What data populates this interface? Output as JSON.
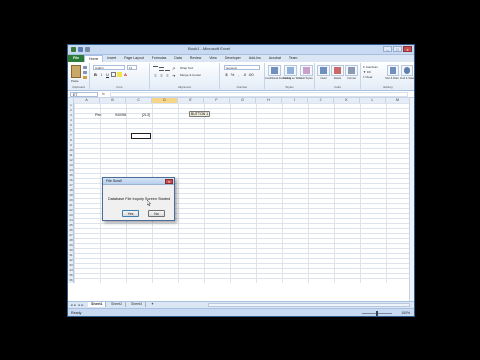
{
  "window": {
    "title": "Book1 - Microsoft Excel",
    "minimize": "–",
    "maximize": "□",
    "close": "x"
  },
  "ribbon_tabs": [
    "File",
    "Home",
    "Insert",
    "Page Layout",
    "Formulas",
    "Data",
    "Review",
    "View",
    "Developer",
    "Add-Ins",
    "Acrobat",
    "Team"
  ],
  "ribbon": {
    "paste": "Paste",
    "font_name": "Calibri",
    "font_size": "11",
    "wrap_text": "Wrap Text",
    "merge_center": "Merge & Center",
    "number_format": "General",
    "conditional_formatting": "Conditional Formatting",
    "format_as_table": "Format as Table",
    "cell_styles": "Cell Styles",
    "insert": "Insert",
    "delete": "Delete",
    "format": "Format",
    "autosum": "AutoSum",
    "fill": "Fill",
    "clear": "Clear",
    "sort_filter": "Sort & Filter",
    "find_select": "Find & Select",
    "groups": [
      "Clipboard",
      "Font",
      "Alignment",
      "Number",
      "Styles",
      "Cells",
      "Editing"
    ]
  },
  "formula_bar": {
    "name_box": "E7",
    "fx": "fx",
    "formula": ""
  },
  "columns": [
    "A",
    "B",
    "C",
    "D",
    "E",
    "F",
    "G",
    "H",
    "I",
    "J",
    "K",
    "L",
    "M"
  ],
  "selected_column": "D",
  "rows": [
    "1",
    "2",
    "3",
    "4",
    "5",
    "6",
    "7",
    "8",
    "9",
    "10",
    "11",
    "12",
    "13",
    "14",
    "15",
    "16",
    "17",
    "18",
    "19",
    "20",
    "21",
    "22",
    "23",
    "24",
    "25",
    "26",
    "27",
    "28",
    "29",
    "30",
    "31",
    "32",
    "33",
    "34",
    "35",
    "36"
  ],
  "cells": {
    "b3": "Pen",
    "c3": "94/098",
    "d3": "[2L3]"
  },
  "sheet_button": "BUTTON 1",
  "dialog": {
    "title": "File Scroll",
    "message": "Database File Inquiry Screen Started",
    "yes": "Yes",
    "no": "No",
    "close": "x"
  },
  "sheets": [
    "Sheet1",
    "Sheet2",
    "Sheet3"
  ],
  "status": {
    "ready": "Ready",
    "zoom": "100%"
  }
}
